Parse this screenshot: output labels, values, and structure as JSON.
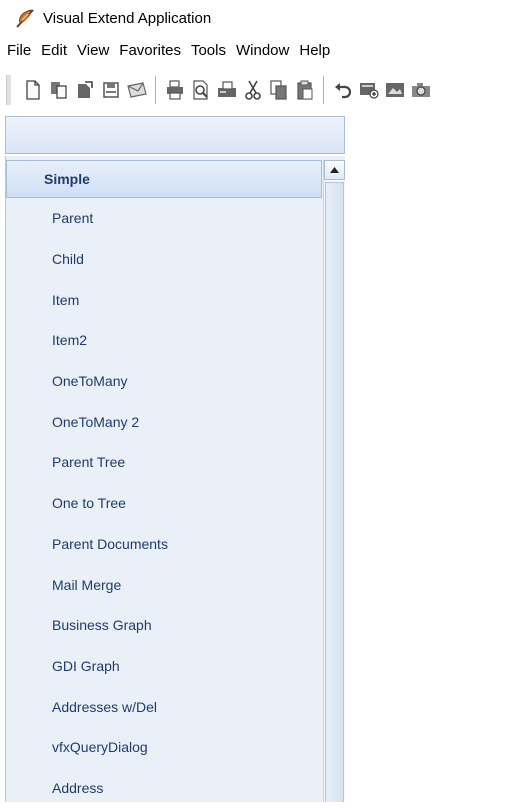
{
  "window": {
    "title": "Visual Extend Application",
    "icon": "app-feather-icon"
  },
  "menubar": {
    "items": [
      {
        "label": "File"
      },
      {
        "label": "Edit"
      },
      {
        "label": "View"
      },
      {
        "label": "Favorites"
      },
      {
        "label": "Tools"
      },
      {
        "label": "Window"
      },
      {
        "label": "Help"
      }
    ]
  },
  "toolbar": {
    "buttons": [
      "new-document-icon",
      "copy-document-icon",
      "open-document-icon",
      "save-icon",
      "envelope-icon",
      "print-icon",
      "print-preview-icon",
      "fax-icon",
      "cut-icon",
      "copy-icon",
      "paste-icon",
      "undo-icon",
      "add-record-icon",
      "image-icon",
      "camera-icon"
    ]
  },
  "sidebar": {
    "group": {
      "label": "Simple"
    },
    "items": [
      {
        "label": "Parent"
      },
      {
        "label": "Child"
      },
      {
        "label": "Item"
      },
      {
        "label": "Item2"
      },
      {
        "label": "OneToMany"
      },
      {
        "label": "OneToMany 2"
      },
      {
        "label": "Parent Tree"
      },
      {
        "label": "One to Tree"
      },
      {
        "label": "Parent Documents"
      },
      {
        "label": "Mail Merge"
      },
      {
        "label": "Business Graph"
      },
      {
        "label": "GDI Graph"
      },
      {
        "label": "Addresses w/Del"
      },
      {
        "label": "vfxQueryDialog"
      },
      {
        "label": "Address"
      }
    ]
  },
  "colors": {
    "accent": "#1f3b6e",
    "panel_bg": "#eaf0f8",
    "header_border": "#a7bed8"
  }
}
